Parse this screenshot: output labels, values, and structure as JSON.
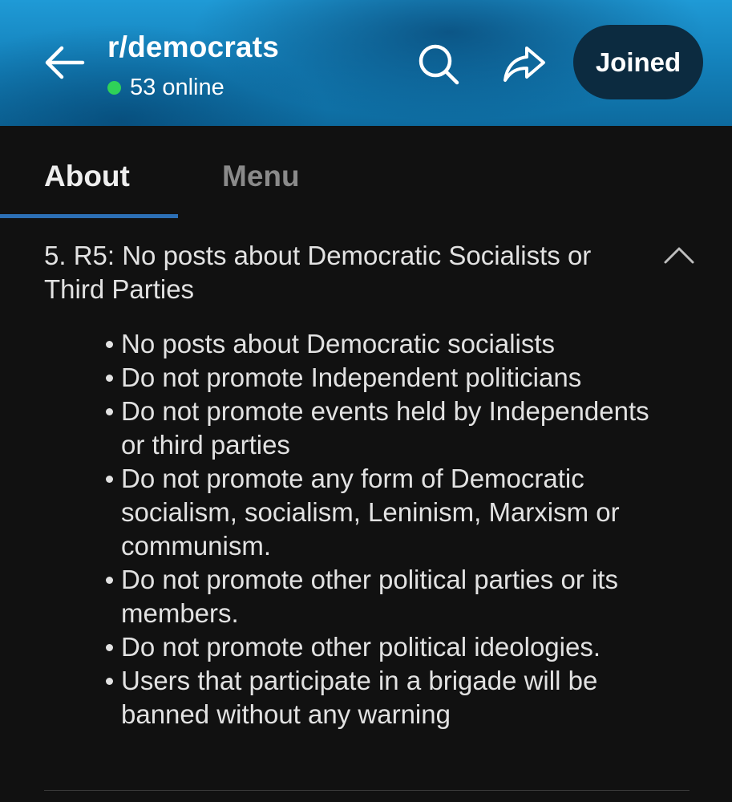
{
  "header": {
    "back_icon": "arrow-left-icon",
    "subreddit_name": "r/democrats",
    "online_count_text": "53 online",
    "online_indicator_color": "#2fd158",
    "search_icon": "search-icon",
    "share_icon": "share-arrow-icon",
    "joined_label": "Joined"
  },
  "tabs": [
    {
      "label": "About",
      "active": true
    },
    {
      "label": "Menu",
      "active": false
    }
  ],
  "accent_color": "#2c6fb5",
  "rule": {
    "title": "5. R5: No posts about Democratic Socialists or Third Parties",
    "expanded": true,
    "collapse_icon": "chevron-up-icon",
    "items": [
      "No posts about Democratic socialists",
      "Do not promote Independent politicians",
      "Do not promote events held by Independents or third parties",
      "Do not promote any form of Democratic socialism, socialism, Leninism, Marxism or communism.",
      "Do not promote other political parties or its members.",
      "Do not promote other political ideologies.",
      "Users that participate in a brigade will be banned without any warning"
    ]
  }
}
